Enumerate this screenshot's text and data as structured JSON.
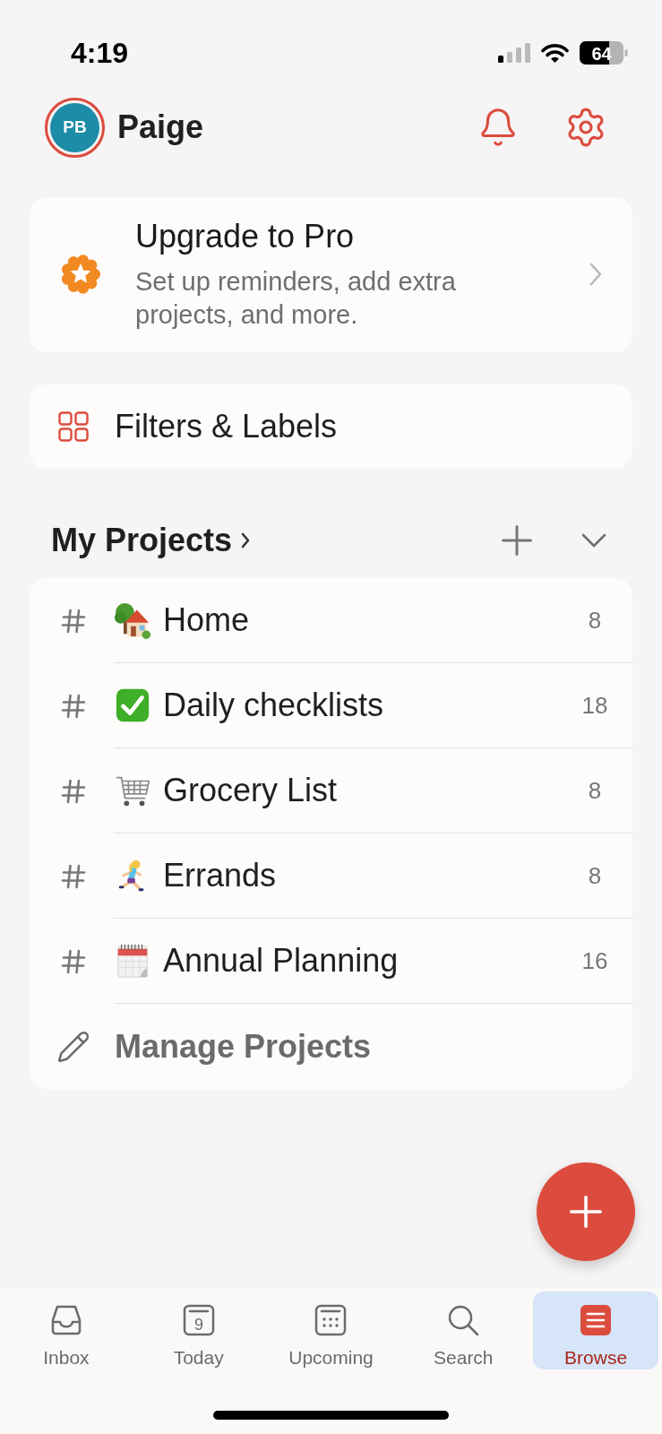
{
  "status_bar": {
    "time": "4:19",
    "battery": "64"
  },
  "header": {
    "avatar_initials": "PB",
    "name": "Paige"
  },
  "upgrade_card": {
    "title": "Upgrade to Pro",
    "description": "Set up reminders, add extra projects, and more."
  },
  "filters_labels": {
    "label": "Filters & Labels"
  },
  "my_projects": {
    "title": "My Projects",
    "expanded": true,
    "projects": [
      {
        "kind": "house",
        "name": "Home",
        "count": "8"
      },
      {
        "kind": "check",
        "name": "Daily checklists",
        "count": "18"
      },
      {
        "kind": "cart",
        "name": "Grocery List",
        "count": "8"
      },
      {
        "kind": "runner",
        "name": "Errands",
        "count": "8"
      },
      {
        "kind": "calendar",
        "name": "Annual Planning",
        "count": "16"
      }
    ],
    "manage_label": "Manage Projects"
  },
  "tab_bar": {
    "tabs": [
      {
        "kind": "inbox",
        "label": "Inbox",
        "selected": false
      },
      {
        "kind": "today",
        "label": "Today",
        "date": "9",
        "selected": false
      },
      {
        "kind": "upcoming",
        "label": "Upcoming",
        "selected": false
      },
      {
        "kind": "search",
        "label": "Search",
        "selected": false
      },
      {
        "kind": "browse",
        "label": "Browse",
        "selected": true
      }
    ]
  }
}
